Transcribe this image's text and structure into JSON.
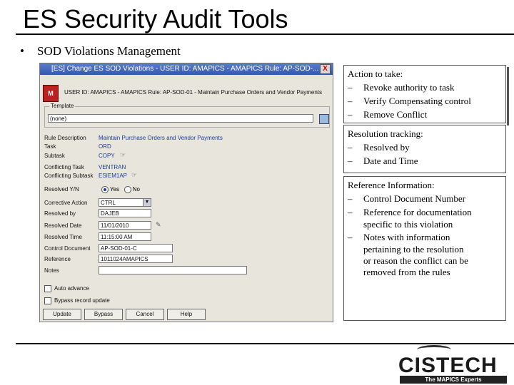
{
  "slide": {
    "title": "ES Security Audit Tools",
    "bullet": "SOD Violations Management"
  },
  "dialog": {
    "title": "[ES] Change ES SOD Violations - USER ID: AMAPICS - AMAPICS      Rule: AP-SOD-...",
    "close_label": "X",
    "logo_label": "M",
    "header_line": "USER ID: AMAPICS - AMAPICS     Rule: AP-SOD-01 - Maintain Purchase Orders and Vendor Payments",
    "template": {
      "label": "Template",
      "value": "(none)"
    },
    "fields": {
      "rule_description": {
        "label": "Rule Description",
        "value": "Maintain Purchase Orders and Vendor Payments"
      },
      "task": {
        "label": "Task",
        "value": "ORD"
      },
      "subtask": {
        "label": "Subtask",
        "value": "COPY"
      },
      "conflicting_task": {
        "label": "Conflicting Task",
        "value": "VENTRAN"
      },
      "conflicting_subtask": {
        "label": "Conflicting Subtask",
        "value": "ESIEM1AP"
      },
      "resolved": {
        "label": "Resolved Y/N",
        "yes": "Yes",
        "no": "No"
      },
      "corrective_action": {
        "label": "Corrective Action",
        "value": "CTRL"
      },
      "resolved_by": {
        "label": "Resolved by",
        "value": "DAJEB"
      },
      "resolved_date": {
        "label": "Resolved Date",
        "value": "11/01/2010"
      },
      "resolved_time": {
        "label": "Resolved Time",
        "value": "11:15:00 AM"
      },
      "control_document": {
        "label": "Control Document",
        "value": "AP-SOD-01-C"
      },
      "reference": {
        "label": "Reference",
        "value": "1011024AMAPICS"
      },
      "notes": {
        "label": "Notes",
        "value": ""
      }
    },
    "checkboxes": {
      "auto_advance": "Auto advance",
      "bypass_update": "Bypass record update"
    },
    "buttons": {
      "update": "Update",
      "bypass": "Bypass",
      "cancel": "Cancel",
      "help": "Help"
    }
  },
  "callouts": {
    "action": {
      "heading": "Action to take:",
      "items": [
        "Revoke authority to task",
        "Verify Compensating control",
        "Remove Conflict"
      ]
    },
    "resolution": {
      "heading": "Resolution tracking:",
      "items": [
        "Resolved by",
        "Date and Time"
      ]
    },
    "reference": {
      "heading": "Reference Information:",
      "item1": "Control Document Number",
      "item2_l1": "Reference for documentation",
      "item2_l2": "specific to this violation",
      "item3_l1": "Notes with information",
      "item3_l2": "pertaining to the resolution",
      "item3_l3": "or reason the conflict can be",
      "item3_l4": "removed from the rules"
    },
    "dash": "–"
  },
  "footer": {
    "logo": "CISTECH",
    "tagline": "The MAPICS Experts"
  }
}
